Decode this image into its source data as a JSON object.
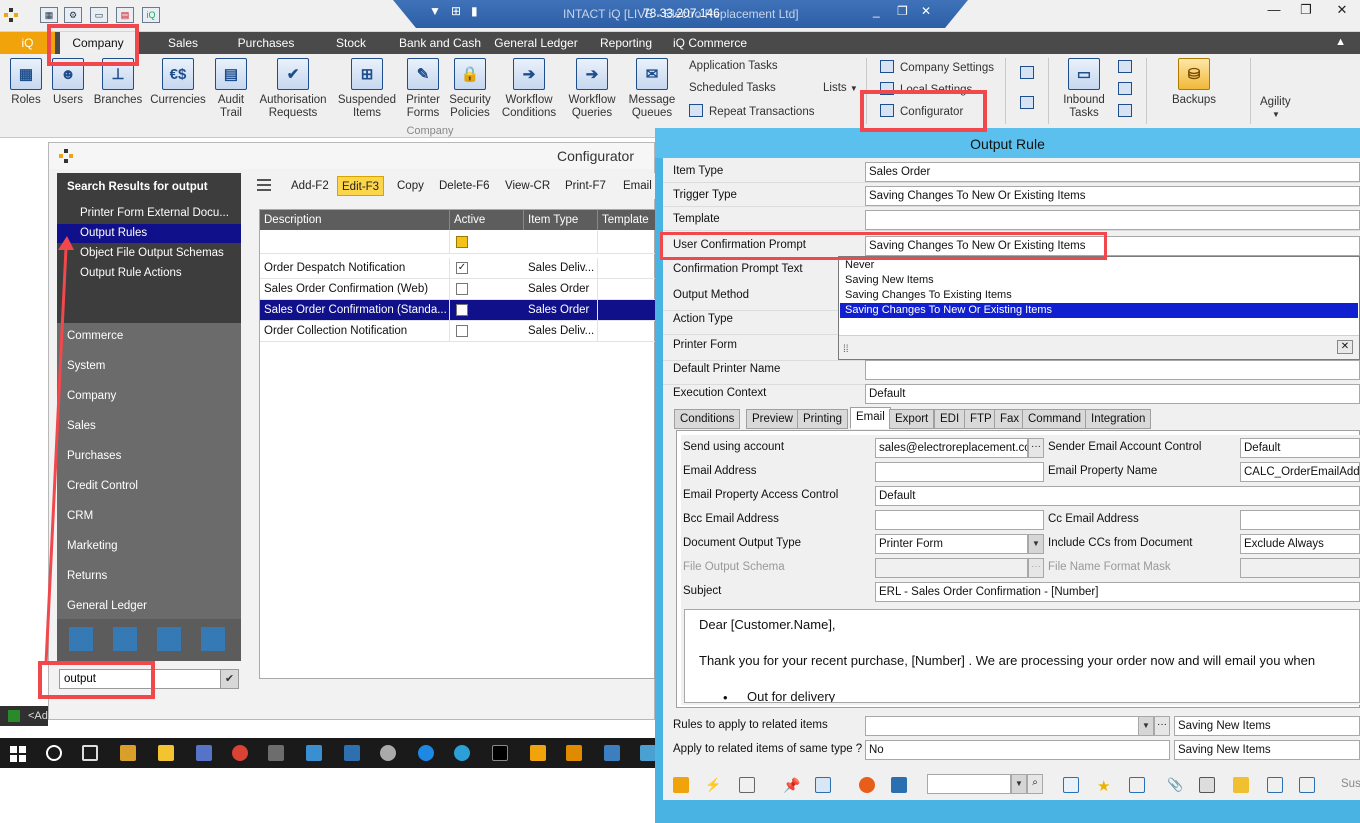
{
  "titlebar": {
    "title": "INTACT iQ [LIVE - Electro Replacement Ltd]",
    "ip": "78.33.207.146"
  },
  "menu": {
    "tabs": [
      "iQ",
      "Company",
      "Sales",
      "Purchases",
      "Stock",
      "Bank and Cash",
      "General Ledger",
      "Reporting",
      "iQ Commerce"
    ]
  },
  "ribbon": {
    "buttons": [
      {
        "label": "Roles",
        "icon": "roles-icon"
      },
      {
        "label": "Users",
        "icon": "users-icon"
      },
      {
        "label": "Branches",
        "icon": "branches-icon"
      },
      {
        "label": "Currencies",
        "icon": "currencies-icon"
      },
      {
        "label": "Audit Trail",
        "icon": "audit-trail-icon"
      },
      {
        "label": "Authorisation Requests",
        "icon": "authorisation-icon"
      },
      {
        "label": "Suspended Items",
        "icon": "suspended-icon"
      },
      {
        "label": "Printer Forms",
        "icon": "printer-forms-icon"
      },
      {
        "label": "Security Policies",
        "icon": "lock-icon"
      },
      {
        "label": "Workflow Conditions",
        "icon": "workflow-icon"
      },
      {
        "label": "Workflow Queries",
        "icon": "workflow-queries-icon"
      },
      {
        "label": "Message Queues",
        "icon": "envelope-icon"
      }
    ],
    "small": {
      "application_tasks": "Application Tasks",
      "scheduled_tasks": "Scheduled Tasks",
      "repeat_transactions": "Repeat Transactions",
      "lists": "Lists",
      "company_settings": "Company Settings",
      "local_settings": "Local Settings",
      "configurator": "Configurator"
    },
    "inbound_tasks": "Inbound Tasks",
    "backups": "Backups",
    "agility": "Agility",
    "group_label": "Company"
  },
  "configurator": {
    "title": "Configurator",
    "search_title": "Search Results for output",
    "search_results": [
      "Printer Form External Docu...",
      "Output Rules",
      "Object File Output Schemas",
      "Output Rule Actions"
    ],
    "categories": [
      "Commerce",
      "System",
      "Company",
      "Sales",
      "Purchases",
      "Credit Control",
      "CRM",
      "Marketing",
      "Returns",
      "General Ledger"
    ],
    "search_value": "output",
    "toolbar": [
      "Add-F2",
      "Edit-F3",
      "Copy",
      "Delete-F6",
      "View-CR",
      "Print-F7",
      "Email"
    ],
    "columns": [
      "Description",
      "Active",
      "Item Type",
      "Template"
    ],
    "rows": [
      {
        "description": "Order Despatch Notification",
        "active": true,
        "item_type": "Sales Deliv..."
      },
      {
        "description": "Sales Order Confirmation (Web)",
        "active": false,
        "item_type": "Sales Order"
      },
      {
        "description": "Sales Order Confirmation (Standa...",
        "active": false,
        "item_type": "Sales Order"
      },
      {
        "description": "Order Collection Notification",
        "active": false,
        "item_type": "Sales Deliv..."
      }
    ]
  },
  "output_rule": {
    "title": "Output Rule",
    "labels": {
      "item_type": "Item Type",
      "trigger_type": "Trigger Type",
      "template": "Template",
      "user_confirmation_prompt": "User Confirmation Prompt",
      "confirmation_prompt_text": "Confirmation Prompt Text",
      "output_method": "Output Method",
      "action_type": "Action Type",
      "printer_form": "Printer Form",
      "default_printer_name": "Default Printer Name",
      "execution_context": "Execution Context"
    },
    "values": {
      "item_type": "Sales Order",
      "trigger_type": "Saving Changes To New Or Existing Items",
      "template": "",
      "user_confirmation_prompt": "Saving Changes To New Or Existing Items",
      "default_printer_name": "",
      "execution_context": "Default"
    },
    "dropdown_options": [
      "Never",
      "Saving New Items",
      "Saving Changes To Existing Items",
      "Saving Changes To New Or Existing Items"
    ],
    "dropdown_selected": 3,
    "tabs": [
      "Conditions",
      "Preview",
      "Printing",
      "Email",
      "Export",
      "EDI",
      "FTP",
      "Fax",
      "Command",
      "Integration"
    ],
    "active_tab": "Email",
    "email": {
      "send_using_account_label": "Send using account",
      "send_using_account": "sales@electroreplacement.co",
      "sender_control_label": "Sender Email Account Control",
      "sender_control": "Default",
      "email_address_label": "Email Address",
      "email_address": "",
      "email_property_name_label": "Email Property Name",
      "email_property_name": "CALC_OrderEmailAddre",
      "email_property_access_label": "Email Property Access Control",
      "email_property_access": "Default",
      "bcc_label": "Bcc Email Address",
      "bcc": "",
      "cc_label": "Cc Email Address",
      "cc": "",
      "doc_output_type_label": "Document Output Type",
      "doc_output_type": "Printer Form",
      "include_ccs_label": "Include CCs from Document",
      "include_ccs": "Exclude Always",
      "file_output_schema_label": "File Output Schema",
      "file_name_mask_label": "File Name Format Mask",
      "subject_label": "Subject",
      "subject": "ERL - Sales Order Confirmation - [Number]",
      "body_lines": [
        "Dear [Customer.Name],",
        "Thank you for your recent purchase, [Number] .   We are processing your order now and will email you when",
        "Out for delivery"
      ]
    },
    "rules_related_label": "Rules to apply to related items",
    "rules_related_value": "Saving New Items",
    "apply_same_type_label": "Apply to related items of same type ?",
    "apply_same_type": "No",
    "apply_same_type_value": "Saving New Items",
    "sus": "Sus"
  },
  "status_left": "<Ad"
}
